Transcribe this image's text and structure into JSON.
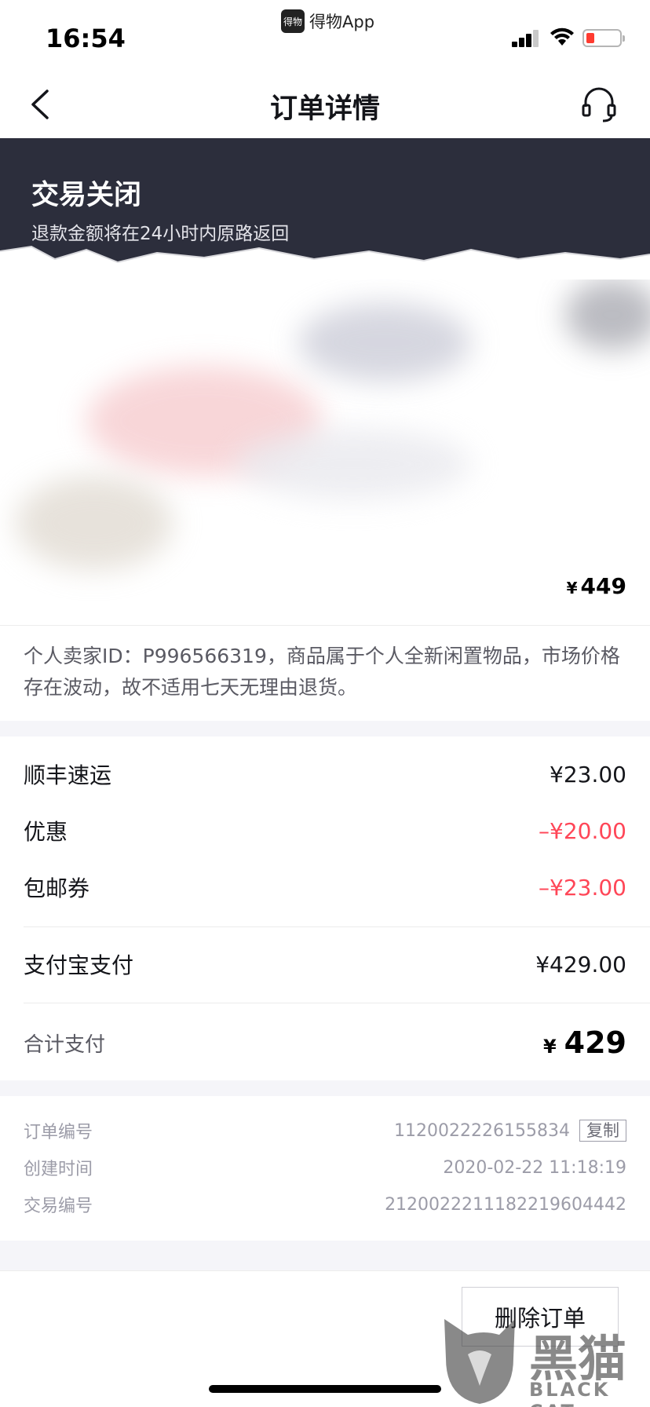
{
  "status_bar": {
    "time": "16:54",
    "app_name": "得物App",
    "app_logo_text": "得物"
  },
  "nav": {
    "title": "订单详情",
    "back_icon": "chevron-left-icon",
    "service_icon": "headset-icon"
  },
  "order_status": {
    "title": "交易关闭",
    "subtitle": "退款金额将在24小时内原路返回"
  },
  "product": {
    "price_currency": "¥",
    "price": "449"
  },
  "seller_note": "个人卖家ID：P996566319，商品属于个人全新闲置物品，市场价格存在波动，故不适用七天无理由退货。",
  "costs": [
    {
      "label": "顺丰速运",
      "value": "¥23.00",
      "discount": false
    },
    {
      "label": "优惠",
      "value": "–¥20.00",
      "discount": true
    },
    {
      "label": "包邮券",
      "value": "–¥23.00",
      "discount": true
    }
  ],
  "payment": {
    "label": "支付宝支付",
    "value": "¥429.00"
  },
  "total": {
    "label": "合计支付",
    "currency": "¥",
    "value": "429"
  },
  "order_info": {
    "order_no_label": "订单编号",
    "order_no": "1120022226155834",
    "copy_label": "复制",
    "created_label": "创建时间",
    "created": "2020-02-22 11:18:19",
    "trade_no_label": "交易编号",
    "trade_no": "2120022211182219604442"
  },
  "actions": {
    "delete_label": "删除订单"
  },
  "watermark": {
    "text": "黑猫",
    "sub": "BLACK CAT"
  },
  "colors": {
    "header_bg": "#2c2e3c",
    "discount": "#ff4657",
    "muted": "#9c9ca8"
  }
}
